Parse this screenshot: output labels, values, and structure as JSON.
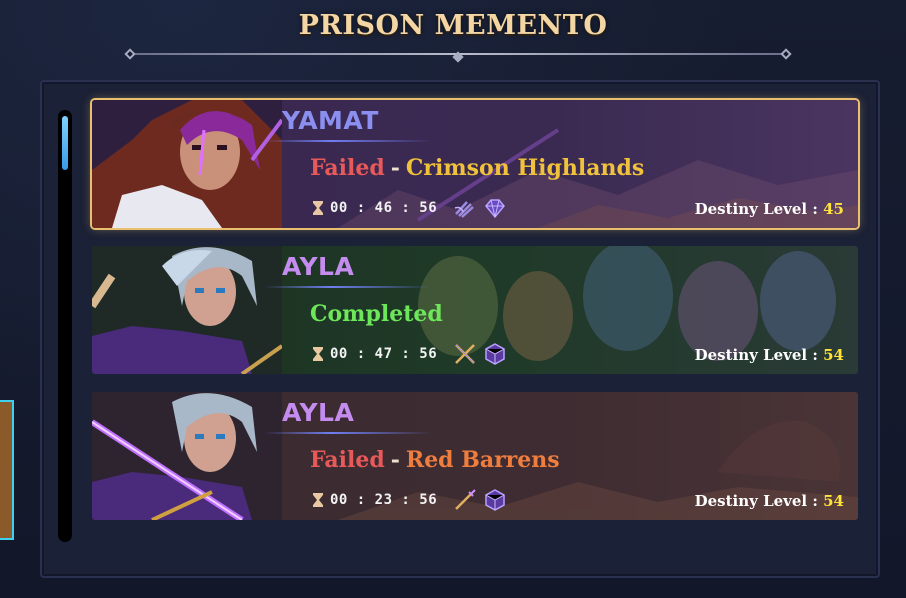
{
  "title": "PRISON MEMENTO",
  "colors": {
    "failed": "#e8595a",
    "completed": "#6ee65a",
    "location_gold": "#f0c23c",
    "location_orange": "#ef7e3e",
    "name_blue": "#8b8ff0",
    "name_purple": "#c58cf0",
    "level_yellow": "#ffe33a",
    "selected_border": "#e8c070"
  },
  "entries": [
    {
      "name": "YAMAT",
      "status": "Failed",
      "location": "Crimson Highlands",
      "time": "00 : 46 : 56",
      "destiny_label": "Destiny Level :",
      "destiny_level": "45",
      "icons": [
        "crossed-claws-icon",
        "purple-gem-icon"
      ]
    },
    {
      "name": "AYLA",
      "status": "Completed",
      "location": "",
      "time": "00 : 47 : 56",
      "destiny_label": "Destiny Level :",
      "destiny_level": "54",
      "icons": [
        "crossed-swords-icon",
        "purple-cube-icon"
      ]
    },
    {
      "name": "AYLA",
      "status": "Failed",
      "location": "Red Barrens",
      "time": "00 : 23 : 56",
      "destiny_label": "Destiny Level :",
      "destiny_level": "54",
      "icons": [
        "spear-icon",
        "purple-cube-icon"
      ]
    }
  ]
}
